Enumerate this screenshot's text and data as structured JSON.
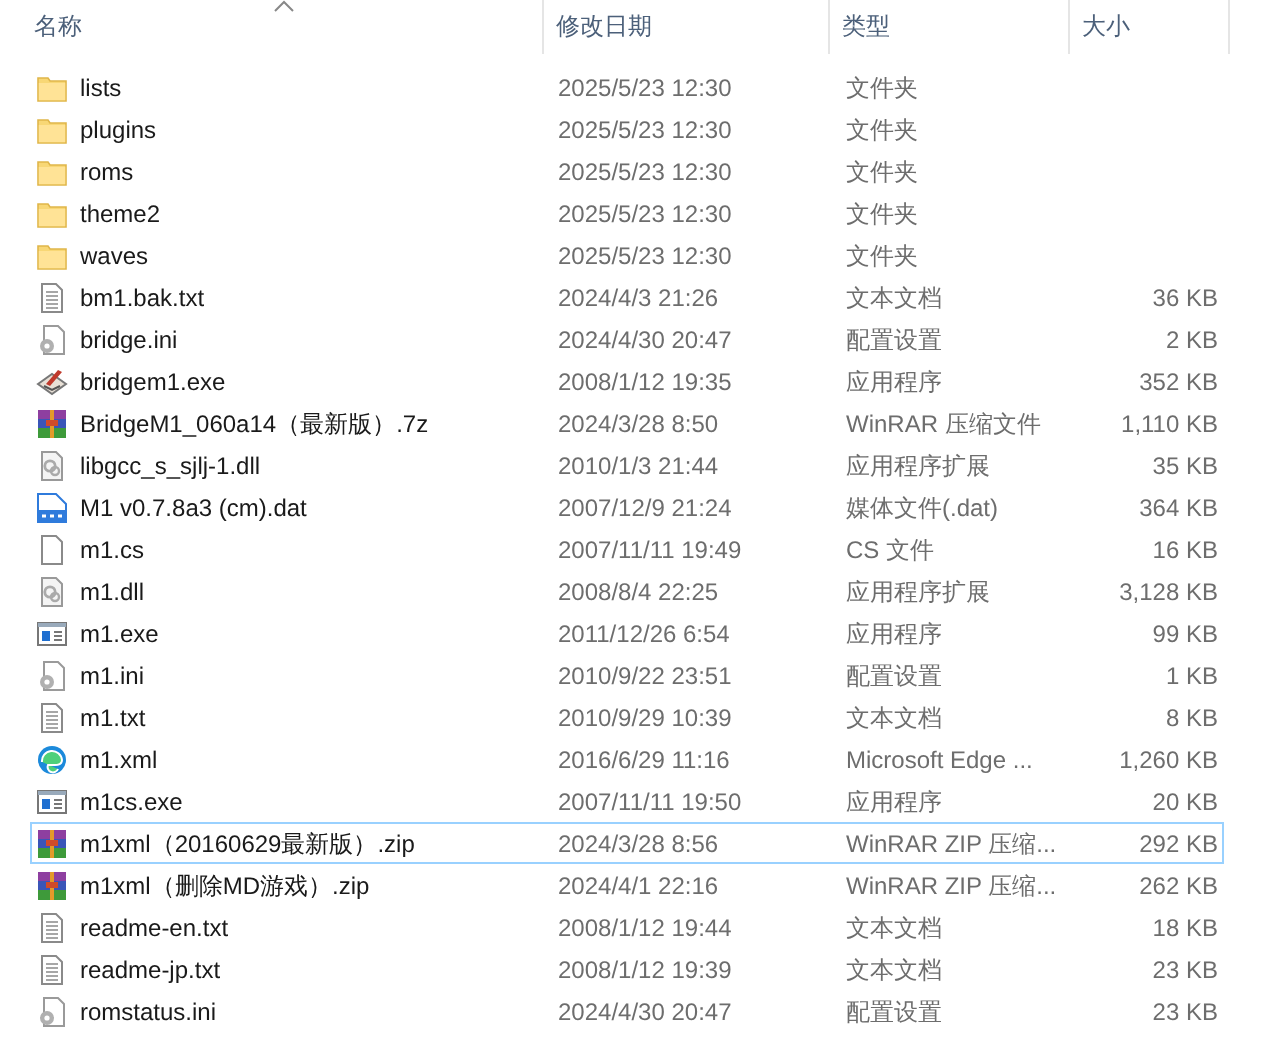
{
  "columns": [
    {
      "label": "名称",
      "sorted": true
    },
    {
      "label": "修改日期",
      "sorted": false
    },
    {
      "label": "类型",
      "sorted": false
    },
    {
      "label": "大小",
      "sorted": false
    }
  ],
  "files": [
    {
      "kind": "folder",
      "name": "lists",
      "modified": "2025/5/23 12:30",
      "type": "文件夹",
      "focused": false
    },
    {
      "kind": "folder",
      "name": "plugins",
      "modified": "2025/5/23 12:30",
      "type": "文件夹",
      "focused": false
    },
    {
      "kind": "folder",
      "name": "roms",
      "modified": "2025/5/23 12:30",
      "type": "文件夹",
      "focused": false
    },
    {
      "kind": "folder",
      "name": "theme2",
      "modified": "2025/5/23 12:30",
      "type": "文件夹",
      "focused": false
    },
    {
      "kind": "folder",
      "name": "waves",
      "modified": "2025/5/23 12:30",
      "type": "文件夹",
      "focused": false
    },
    {
      "kind": "text",
      "name": "bm1.bak.txt",
      "modified": "2024/4/3 21:26",
      "type": "文本文档",
      "size": "36 KB",
      "focused": false
    },
    {
      "kind": "config",
      "name": "bridge.ini",
      "modified": "2024/4/30 20:47",
      "type": "配置设置",
      "size": "2 KB",
      "focused": false
    },
    {
      "kind": "installer",
      "name": "bridgem1.exe",
      "modified": "2008/1/12 19:35",
      "type": "应用程序",
      "size": "352 KB",
      "focused": false
    },
    {
      "kind": "archive",
      "name": "BridgeM1_060a14（最新版）.7z",
      "modified": "2024/3/28 8:50",
      "type": "WinRAR 压缩文件",
      "size": "1,110 KB",
      "focused": false
    },
    {
      "kind": "library",
      "name": "libgcc_s_sjlj-1.dll",
      "modified": "2010/1/3 21:44",
      "type": "应用程序扩展",
      "size": "35 KB",
      "focused": false
    },
    {
      "kind": "media",
      "name": "M1 v0.7.8a3 (cm).dat",
      "modified": "2007/12/9 21:24",
      "type": "媒体文件(.dat)",
      "size": "364 KB",
      "focused": false
    },
    {
      "kind": "blank",
      "name": "m1.cs",
      "modified": "2007/11/11 19:49",
      "type": "CS 文件",
      "size": "16 KB",
      "focused": false
    },
    {
      "kind": "library",
      "name": "m1.dll",
      "modified": "2008/8/4 22:25",
      "type": "应用程序扩展",
      "size": "3,128 KB",
      "focused": false
    },
    {
      "kind": "app",
      "name": "m1.exe",
      "modified": "2011/12/26 6:54",
      "type": "应用程序",
      "size": "99 KB",
      "focused": false
    },
    {
      "kind": "config",
      "name": "m1.ini",
      "modified": "2010/9/22 23:51",
      "type": "配置设置",
      "size": "1 KB",
      "focused": false
    },
    {
      "kind": "text",
      "name": "m1.txt",
      "modified": "2010/9/29 10:39",
      "type": "文本文档",
      "size": "8 KB",
      "focused": false
    },
    {
      "kind": "browser",
      "name": "m1.xml",
      "modified": "2016/6/29 11:16",
      "type": "Microsoft Edge ...",
      "size": "1,260 KB",
      "focused": false
    },
    {
      "kind": "app",
      "name": "m1cs.exe",
      "modified": "2007/11/11 19:50",
      "type": "应用程序",
      "size": "20 KB",
      "focused": false
    },
    {
      "kind": "archive",
      "name": "m1xml（20160629最新版）.zip",
      "modified": "2024/3/28 8:56",
      "type": "WinRAR ZIP 压缩...",
      "size": "292 KB",
      "focused": true
    },
    {
      "kind": "archive",
      "name": "m1xml（删除MD游戏）.zip",
      "modified": "2024/4/1 22:16",
      "type": "WinRAR ZIP 压缩...",
      "size": "262 KB",
      "focused": false
    },
    {
      "kind": "text",
      "name": "readme-en.txt",
      "modified": "2008/1/12 19:44",
      "type": "文本文档",
      "size": "18 KB",
      "focused": false
    },
    {
      "kind": "text",
      "name": "readme-jp.txt",
      "modified": "2008/1/12 19:39",
      "type": "文本文档",
      "size": "23 KB",
      "focused": false
    },
    {
      "kind": "config",
      "name": "romstatus.ini",
      "modified": "2024/4/30 20:47",
      "type": "配置设置",
      "size": "23 KB",
      "focused": false
    }
  ]
}
